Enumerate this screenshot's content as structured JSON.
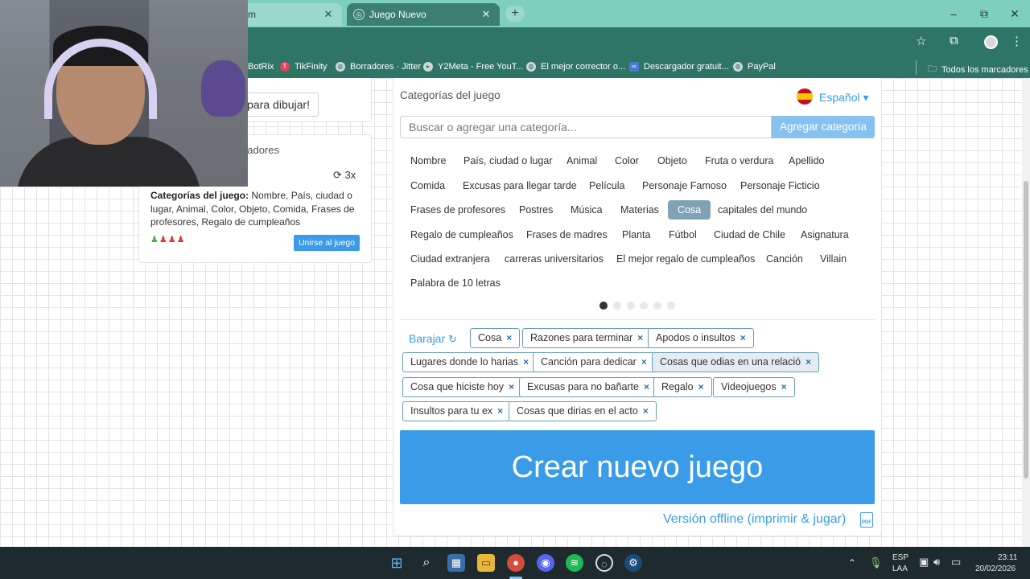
{
  "browser": {
    "tabs": [
      {
        "label": "m",
        "active": false
      },
      {
        "label": "Juego Nuevo",
        "active": true
      }
    ],
    "new_tab_label": "+",
    "window_controls": {
      "minimize": "–",
      "maximize": "⧉",
      "close": "✕"
    },
    "bookmarks": [
      {
        "label": "BotRix",
        "icon": "bookmark-icon"
      },
      {
        "label": "TikFinity",
        "icon": "tikfinity-icon"
      },
      {
        "label": "Borradores · Jitter",
        "icon": "globe-icon"
      },
      {
        "label": "Y2Meta - Free YouT...",
        "icon": "y2meta-icon"
      },
      {
        "label": "El mejor corrector o...",
        "icon": "globe-icon"
      },
      {
        "label": "Descargador gratuit...",
        "icon": "download-icon"
      },
      {
        "label": "PayPal",
        "icon": "globe-icon"
      }
    ],
    "all_bookmarks": "Todos los marcadores"
  },
  "sidebar": {
    "draw_button": "ento para dibujar!",
    "players_label": "gadores",
    "rounds": "3x",
    "game_info_label": "Categorías del juego:",
    "game_info_text": " Nombre, País, ciudad o lugar, Animal, Color, Objeto, Comida, Frases de profesores, Regalo de cumpleaños",
    "join_button": "Unirse al juego",
    "player_icons": "♟♟♟♟"
  },
  "main": {
    "title": "Categorías del juego",
    "language": "Español",
    "search_placeholder": "Buscar o agregar una categoría...",
    "add_button": "Agregar categoría",
    "categories": [
      "Nombre",
      "País, ciudad o lugar",
      "Animal",
      "Color",
      "Objeto",
      "Fruta o verdura",
      "Apellido",
      "Comida",
      "Excusas para llegar tarde",
      "Película",
      "Personaje Famoso",
      "Personaje Ficticio",
      "Frases de profesores",
      "Postres",
      "Música",
      "Materias",
      "Cosa",
      "capitales del mundo",
      "Regalo de cumpleaños",
      "Frases de madres",
      "Planta",
      "Fútbol",
      "Ciudad de Chile",
      "Asignatura",
      "Ciudad extranjera",
      "carreras universitarios",
      "El mejor regalo de cumpleaños",
      "Canción",
      "Villain",
      "Palabra de 10 letras"
    ],
    "active_category": "Cosa",
    "carousel": {
      "pages": 6,
      "current": 1
    },
    "shuffle_label": "Barajar",
    "selected_tags": [
      "Cosa",
      "Razones para terminar",
      "Apodos o insultos",
      "Lugares donde lo harias",
      "Canción para dedicar",
      "Cosas que odias en una relació",
      "Cosa que hiciste hoy",
      "Excusas para no bañarte",
      "Regalo",
      "Videojuegos",
      "Insultos para tu ex",
      "Cosas que dirias en el acto"
    ],
    "tag_remove": "×",
    "create_button": "Crear nuevo juego",
    "offline_link": "Versión offline (imprimir & jugar)",
    "pdf_label": "PDF"
  },
  "taskbar": {
    "lang": "ESP",
    "lang2": "LAA",
    "time": "23:11",
    "date": "20/02/2026"
  },
  "colors": {
    "accent": "#3a9be8",
    "tab_bar": "#7fcfbd",
    "toolbar": "#2f7566",
    "active_category": "#7fa3b5"
  }
}
